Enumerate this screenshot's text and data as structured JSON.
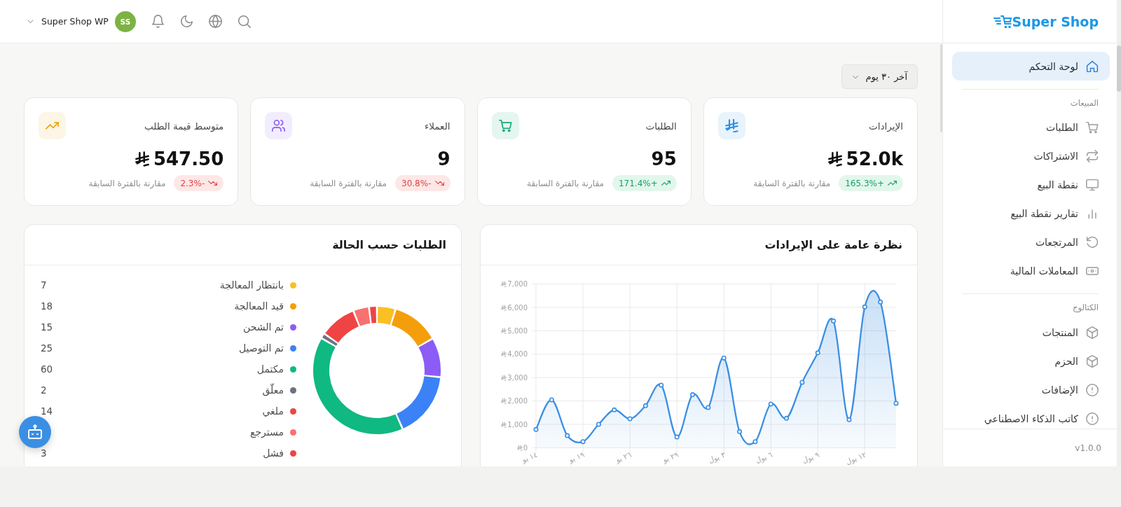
{
  "topbar": {
    "store": "Super Shop WP",
    "avatar": "SS"
  },
  "sidebar": {
    "logo": "Super Shop",
    "sections": [
      {
        "items": [
          {
            "label": "لوحة التحكم",
            "selected": true
          }
        ]
      },
      {
        "title": "المبيعات",
        "items": [
          {
            "label": "الطلبات",
            "selected": false
          },
          {
            "label": "الاشتراكات",
            "selected": false
          },
          {
            "label": "نقطة البيع",
            "selected": false
          },
          {
            "label": "تقارير نقطة البيع",
            "selected": false
          },
          {
            "label": "المرتجعات",
            "selected": false
          },
          {
            "label": "المعاملات المالية",
            "selected": false
          }
        ]
      },
      {
        "title": "الكتالوج",
        "items": [
          {
            "label": "المنتجات",
            "selected": false
          },
          {
            "label": "الحزم",
            "selected": false
          },
          {
            "label": "الإضافات",
            "selected": false
          },
          {
            "label": "كاتب الذكاء الاصطناعي",
            "selected": false
          }
        ]
      }
    ],
    "version": "v1.0.0"
  },
  "date_filter": {
    "value": "آخر ٣٠ يوم"
  },
  "stats": [
    {
      "label": "الإيرادات",
      "value": "52.0k",
      "currency": true,
      "color": "#2f8ee5",
      "change": "+165.3%",
      "kind": "up",
      "comparison": "مقارنة بالفترة السابقة"
    },
    {
      "label": "الطلبات",
      "value": "95",
      "currency": false,
      "color": "#16a874",
      "change": "+171.4%",
      "kind": "up",
      "comparison": "مقارنة بالفترة السابقة"
    },
    {
      "label": "العملاء",
      "value": "9",
      "currency": false,
      "color": "#8b5cf6",
      "change": "-30.8%",
      "kind": "down",
      "comparison": "مقارنة بالفترة السابقة"
    },
    {
      "label": "متوسط قيمة الطلب",
      "value": "547.50",
      "currency": true,
      "color": "#e9a50f",
      "change": "-2.3%",
      "kind": "down",
      "comparison": "مقارنة بالفترة السابقة"
    }
  ],
  "revenue_chart": {
    "title": "نظرة عامة على الإيرادات",
    "chart_data": {
      "type": "area",
      "grid": true,
      "ylim": [
        0,
        7000
      ],
      "yticks": [
        {
          "value": 0,
          "label": "0"
        },
        {
          "value": 1000,
          "label": "1,000"
        },
        {
          "value": 2000,
          "label": "2,000"
        },
        {
          "value": 3000,
          "label": "3,000"
        },
        {
          "value": 4000,
          "label": "4,000"
        },
        {
          "value": 5000,
          "label": "5,000"
        },
        {
          "value": 6000,
          "label": "6,000"
        },
        {
          "value": 7000,
          "label": "7,000"
        }
      ],
      "categories": [
        "١٤ يو",
        null,
        null,
        "١٩ يو",
        null,
        null,
        "٢٦ يو",
        null,
        null,
        "٢٩ يو",
        null,
        null,
        "٣ يول",
        null,
        null,
        "٦ يول",
        null,
        null,
        "٩ يول",
        null,
        null,
        "١٢ يول",
        null,
        null
      ],
      "series": [
        {
          "color": "#3b8fe3",
          "values": [
            780,
            2050,
            520,
            260,
            1000,
            1620,
            1240,
            1800,
            2680,
            460,
            2270,
            1720,
            3840,
            690,
            260,
            1870,
            1260,
            2800,
            4060,
            5420,
            1200,
            6020,
            6230,
            1900
          ]
        }
      ]
    }
  },
  "orders_by_status": {
    "title": "الطلبات حسب الحالة",
    "legend": [
      {
        "label": "بانتظار المعالجة",
        "value": "7",
        "color": "#fbbf24"
      },
      {
        "label": "قيد المعالجة",
        "value": "18",
        "color": "#f59e0b"
      },
      {
        "label": "تم الشحن",
        "value": "15",
        "color": "#8b5cf6"
      },
      {
        "label": "تم التوصيل",
        "value": "25",
        "color": "#3b82f6"
      },
      {
        "label": "مكتمل",
        "value": "60",
        "color": "#10b981"
      },
      {
        "label": "معلّق",
        "value": "2",
        "color": "#6b7280"
      },
      {
        "label": "ملغي",
        "value": "14",
        "color": "#ef4444"
      },
      {
        "label": "مسترجع",
        "color": "#f87171"
      },
      {
        "label": "فشل",
        "value": "3",
        "color": "#ef4444"
      }
    ],
    "chart_data": {
      "type": "donut",
      "values": [
        4.7,
        12,
        10,
        16.7,
        40,
        1.3,
        9.3,
        4,
        2
      ]
    }
  }
}
